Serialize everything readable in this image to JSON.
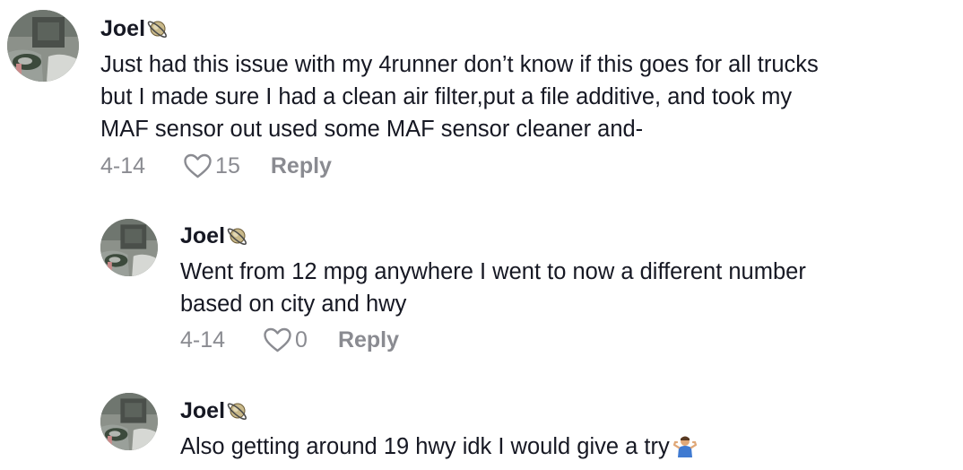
{
  "comments": [
    {
      "username": "Joel",
      "badge_icon": "planet-icon",
      "lines": [
        "Just had this issue with my 4runner don’t know if this goes for all trucks",
        "but I made sure I had a clean air filter,put a file additive, and took my",
        "MAF sensor out used some MAF sensor cleaner and-"
      ],
      "date": "4-14",
      "likes": "15",
      "reply_label": "Reply"
    },
    {
      "username": "Joel",
      "badge_icon": "planet-icon",
      "lines": [
        "Went from 12 mpg anywhere I went to now a different number",
        "based on city and hwy"
      ],
      "date": "4-14",
      "likes": "0",
      "reply_label": "Reply"
    },
    {
      "username": "Joel",
      "badge_icon": "planet-icon",
      "lines": [
        "Also getting around 19 hwy idk I would give a try"
      ],
      "trailing_emoji": "person-shrugging-icon"
    }
  ],
  "colors": {
    "text": "#161823",
    "meta": "#8a8b91"
  }
}
